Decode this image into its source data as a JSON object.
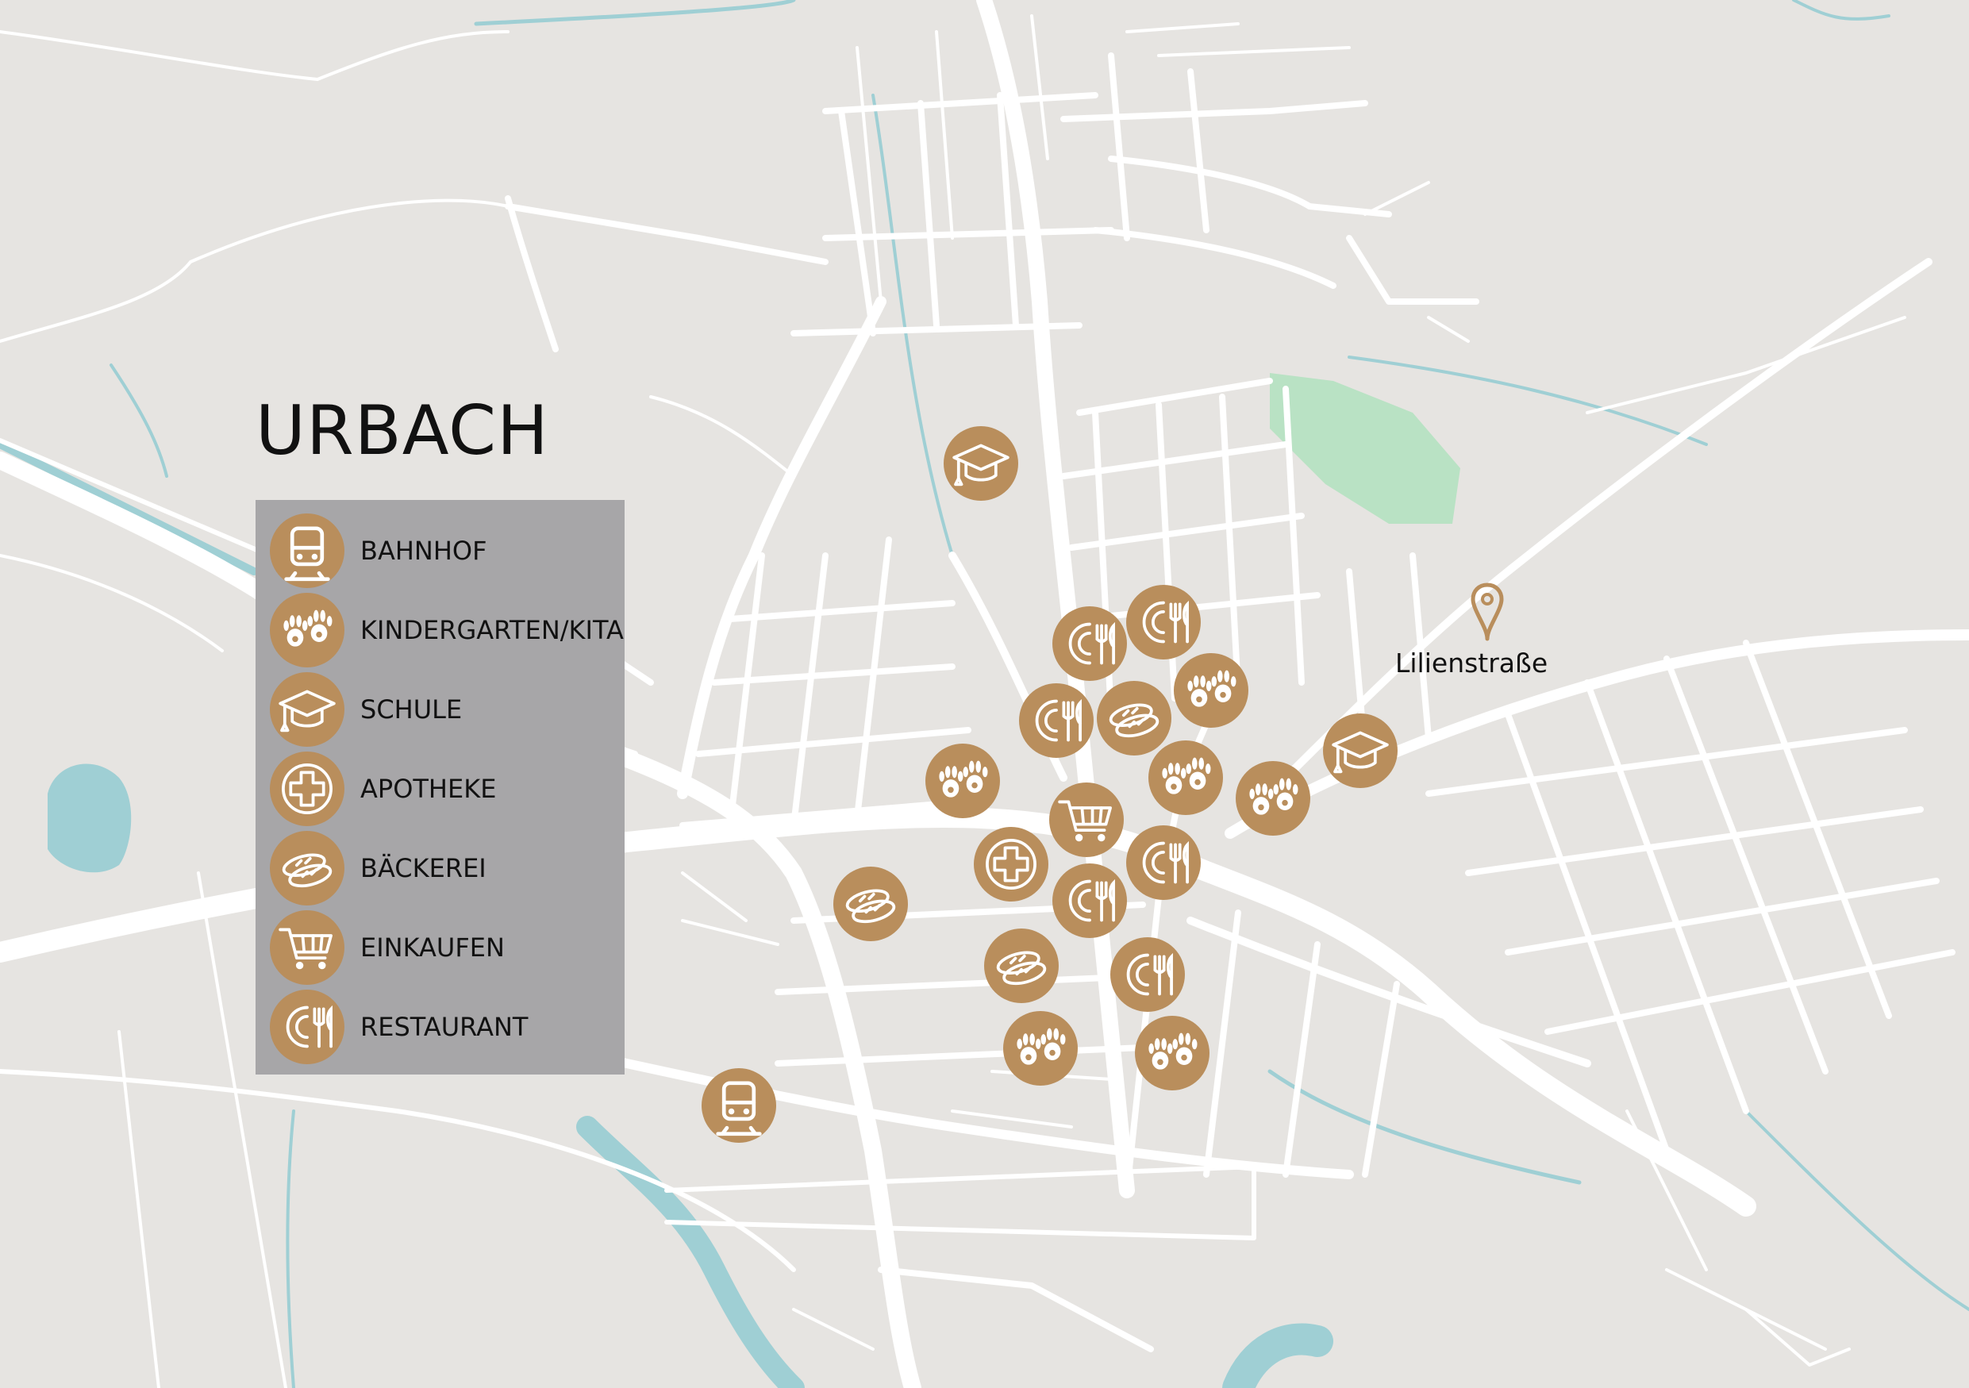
{
  "map": {
    "title": "URBACH",
    "location_label": "Lilienstraße",
    "colors": {
      "background": "#e6e4e1",
      "road": "#ffffff",
      "water": "#9fcfd4",
      "park": "#b9e2c4",
      "marker": "#b98e5c",
      "legend_bg": "#a7a6a8"
    }
  },
  "legend": {
    "items": [
      {
        "label": "BAHNHOF",
        "icon": "train-icon"
      },
      {
        "label": "KINDERGARTEN/KITA",
        "icon": "hands-icon"
      },
      {
        "label": "SCHULE",
        "icon": "graduation-cap-icon"
      },
      {
        "label": "APOTHEKE",
        "icon": "pharmacy-cross-icon"
      },
      {
        "label": "BÄCKEREI",
        "icon": "bread-icon"
      },
      {
        "label": "EINKAUFEN",
        "icon": "shopping-cart-icon"
      },
      {
        "label": "RESTAURANT",
        "icon": "restaurant-icon"
      }
    ]
  },
  "markers": [
    {
      "category": "SCHULE",
      "icon": "graduation-cap-icon"
    },
    {
      "category": "RESTAURANT",
      "icon": "restaurant-icon"
    },
    {
      "category": "RESTAURANT",
      "icon": "restaurant-icon"
    },
    {
      "category": "KINDERGARTEN/KITA",
      "icon": "hands-icon"
    },
    {
      "category": "RESTAURANT",
      "icon": "restaurant-icon"
    },
    {
      "category": "BÄCKEREI",
      "icon": "bread-icon"
    },
    {
      "category": "KINDERGARTEN/KITA",
      "icon": "hands-icon"
    },
    {
      "category": "KINDERGARTEN/KITA",
      "icon": "hands-icon"
    },
    {
      "category": "KINDERGARTEN/KITA",
      "icon": "hands-icon"
    },
    {
      "category": "SCHULE",
      "icon": "graduation-cap-icon"
    },
    {
      "category": "EINKAUFEN",
      "icon": "shopping-cart-icon"
    },
    {
      "category": "APOTHEKE",
      "icon": "pharmacy-cross-icon"
    },
    {
      "category": "RESTAURANT",
      "icon": "restaurant-icon"
    },
    {
      "category": "RESTAURANT",
      "icon": "restaurant-icon"
    },
    {
      "category": "BÄCKEREI",
      "icon": "bread-icon"
    },
    {
      "category": "BÄCKEREI",
      "icon": "bread-icon"
    },
    {
      "category": "RESTAURANT",
      "icon": "restaurant-icon"
    },
    {
      "category": "KINDERGARTEN/KITA",
      "icon": "hands-icon"
    },
    {
      "category": "KINDERGARTEN/KITA",
      "icon": "hands-icon"
    },
    {
      "category": "BAHNHOF",
      "icon": "train-icon"
    }
  ]
}
